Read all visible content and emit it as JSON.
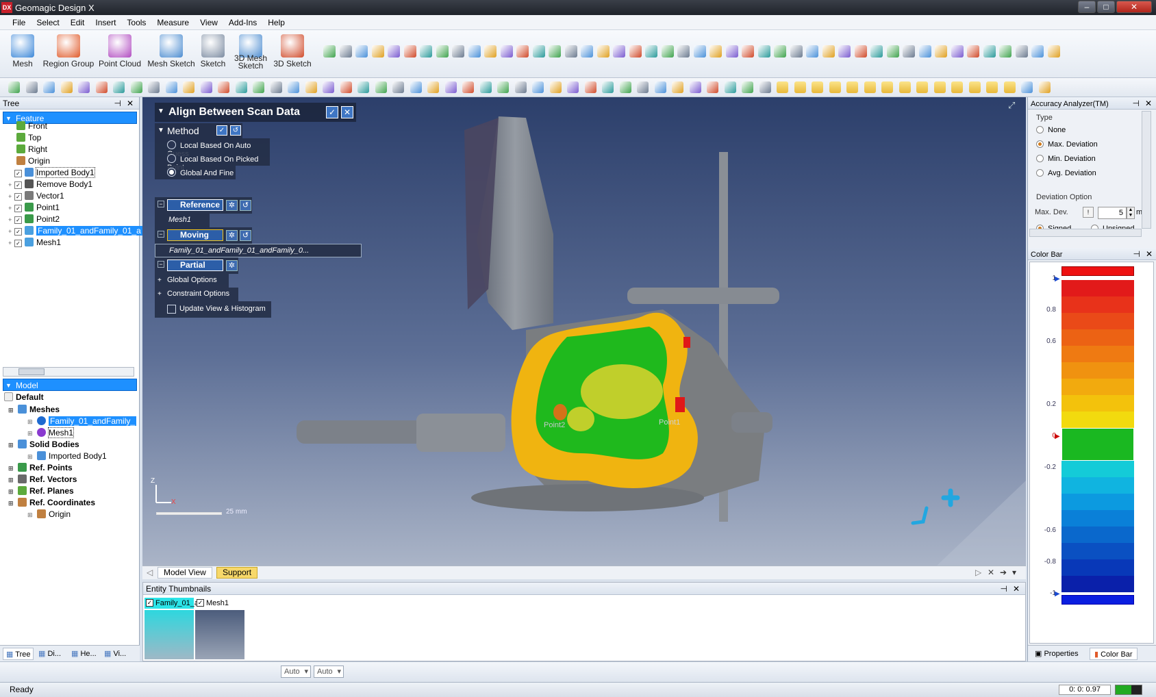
{
  "app": {
    "title": "Geomagic Design X",
    "logo": "DX"
  },
  "menu": [
    "File",
    "Select",
    "Edit",
    "Insert",
    "Tools",
    "Measure",
    "View",
    "Add-Ins",
    "Help"
  ],
  "ribbon": {
    "buttons": [
      {
        "label": "Mesh",
        "icon": "mesh-icon",
        "color": "#3a86d8"
      },
      {
        "label": "Region Group",
        "icon": "region-group-icon",
        "color": "#e05a2a"
      },
      {
        "label": "Point Cloud",
        "icon": "point-cloud-icon",
        "color": "#b04ac0"
      },
      {
        "label": "Mesh Sketch",
        "icon": "mesh-sketch-icon",
        "color": "#4a8bd0"
      },
      {
        "label": "Sketch",
        "icon": "sketch-icon",
        "color": "#7a8aa0"
      },
      {
        "label": "3D Mesh\nSketch",
        "label_line1": "3D Mesh",
        "label_line2": "Sketch",
        "icon": "3d-mesh-sketch-icon",
        "color": "#4a8bd0"
      },
      {
        "label": "3D Sketch",
        "icon": "3d-sketch-icon",
        "color": "#d04a2a"
      }
    ]
  },
  "tree": {
    "title": "Tree",
    "feature_header": "Feature",
    "features": [
      {
        "label": "Front",
        "icon": "plane-icon"
      },
      {
        "label": "Top",
        "icon": "plane-icon"
      },
      {
        "label": "Right",
        "icon": "plane-icon"
      },
      {
        "label": "Origin",
        "icon": "coordinate-icon"
      },
      {
        "label": "Imported Body1",
        "icon": "body-icon"
      },
      {
        "label": "Remove Body1",
        "icon": "remove-body-icon"
      },
      {
        "label": "Vector1",
        "icon": "vector-icon"
      },
      {
        "label": "Point1",
        "icon": "point-icon"
      },
      {
        "label": "Point2",
        "icon": "point-icon"
      },
      {
        "label": "Family_01_andFamily_01_a",
        "icon": "mesh-icon"
      },
      {
        "label": "Mesh1",
        "icon": "mesh-icon"
      }
    ],
    "model_header": "Model",
    "model_default": "Default",
    "model": [
      {
        "label": "Meshes",
        "bold": true
      },
      {
        "label": "Family_01_andFamily_",
        "bold": false
      },
      {
        "label": "Mesh1",
        "bold": false
      },
      {
        "label": "Solid Bodies",
        "bold": true
      },
      {
        "label": "Imported Body1",
        "bold": false
      },
      {
        "label": "Ref. Points",
        "bold": true
      },
      {
        "label": "Ref. Vectors",
        "bold": true
      },
      {
        "label": "Ref. Planes",
        "bold": true
      },
      {
        "label": "Ref. Coordinates",
        "bold": true
      },
      {
        "label": "Origin",
        "bold": false
      }
    ],
    "tabs": [
      "Tree",
      "Di...",
      "He...",
      "Vi..."
    ]
  },
  "dialog": {
    "title": "Align Between Scan Data",
    "method_label": "Method",
    "methods": [
      "Local Based On Auto Guess",
      "Local Based On Picked Point",
      "Global And Fine"
    ],
    "selected_method": "Global And Fine",
    "reference_label": "Reference",
    "reference_value": "Mesh1",
    "moving_label": "Moving",
    "moving_value": "Family_01_andFamily_01_andFamily_0...",
    "partial_label": "Partial",
    "global_options": "Global Options",
    "constraint_options": "Constraint Options",
    "update_view": "Update View & Histogram"
  },
  "viewport": {
    "scale_label": "25 mm",
    "axis_z": "Z",
    "axis_x": "X",
    "point_labels": [
      "Point1",
      "Point2"
    ],
    "tabs": [
      "Model View",
      "Support"
    ]
  },
  "thumbnails": {
    "title": "Entity Thumbnails",
    "items": [
      {
        "label": "Family_01_a"
      },
      {
        "label": "Mesh1"
      }
    ]
  },
  "accuracy": {
    "title": "Accuracy Analyzer(TM)",
    "type_label": "Type",
    "types": [
      "None",
      "Max. Deviation",
      "Min. Deviation",
      "Avg. Deviation"
    ],
    "selected_type": "Max. Deviation",
    "deviation_option": "Deviation Option",
    "max_dev_label": "Max. Dev.",
    "max_dev_value": "5",
    "unit": "m",
    "signed": "Signed",
    "unsigned": "Unsigned"
  },
  "colorbar": {
    "title": "Color Bar",
    "ticks": [
      "1",
      "0.8",
      "0.6",
      "0.2",
      "0",
      "-0.2",
      "-0.6",
      "-0.8",
      "-1"
    ],
    "colors": [
      "#e21a1a",
      "#e8321a",
      "#ea4a18",
      "#ec6214",
      "#ef7a12",
      "#f09210",
      "#f2aa0e",
      "#f3c20c",
      "#f2da0e",
      "#1ab821",
      "#1ab821",
      "#14cbd8",
      "#10b4e0",
      "#0c9ae0",
      "#0a80d8",
      "#0a68cc",
      "#0a50c2",
      "#0838b8",
      "#0a20aa"
    ],
    "tabs": [
      "Properties",
      "Color Bar"
    ]
  },
  "bottom": {
    "auto1": "Auto",
    "auto2": "Auto"
  },
  "status": {
    "text": "Ready",
    "time": "0: 0: 0.97"
  }
}
